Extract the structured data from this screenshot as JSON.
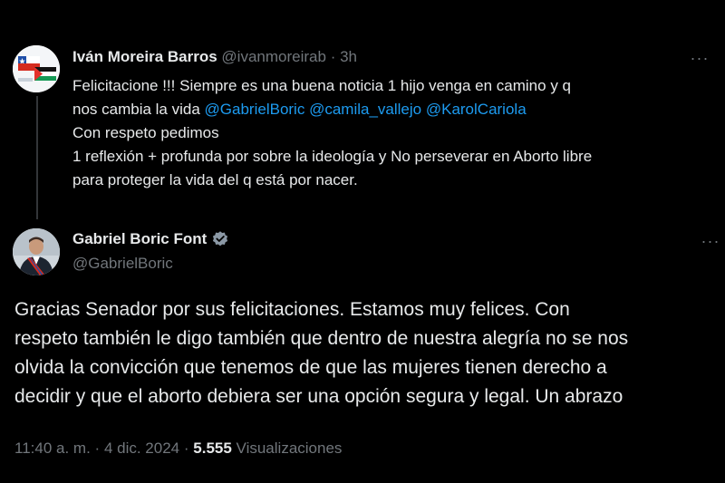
{
  "reply_tweet": {
    "author_name": "Iván Moreira Barros",
    "handle": "@ivanmoreirab",
    "separator": "·",
    "time": "3h",
    "text_lines": [
      "Felicitacione !!! Siempre es una buena noticia 1 hijo venga en camino y q",
      "nos cambia la vida",
      "Con respeto pedimos",
      "1 reflexión + profunda por sobre la ideología y No perseverar en Aborto libre",
      "para proteger la vida del q está por nacer."
    ],
    "mentions": [
      "@GabrielBoric",
      "@camila_vallejo",
      "@KarolCariola"
    ],
    "more_icon": "more-horizontal-icon"
  },
  "main_tweet": {
    "author_name": "Gabriel Boric Font",
    "handle": "@GabrielBoric",
    "verified_icon": "verified-badge-icon",
    "more_icon": "more-horizontal-icon",
    "text_lines": [
      "Gracias Senador por sus felicitaciones. Estamos muy felices. Con",
      "respeto también le digo también que dentro de nuestra alegría no se nos",
      "olvida la convicción que tenemos de que las mujeres tienen derecho a",
      "decidir y que el aborto debiera ser una opción segura y legal. Un abrazo"
    ],
    "time": "11:40 a. m.",
    "separator": "·",
    "date": "4 dic. 2024",
    "views_count": "5.555",
    "views_label": "Visualizaciones"
  },
  "colors": {
    "background": "#000000",
    "text": "#e7e9ea",
    "muted": "#71767b",
    "link": "#1d9bf0",
    "verified": "#8b98a5"
  }
}
